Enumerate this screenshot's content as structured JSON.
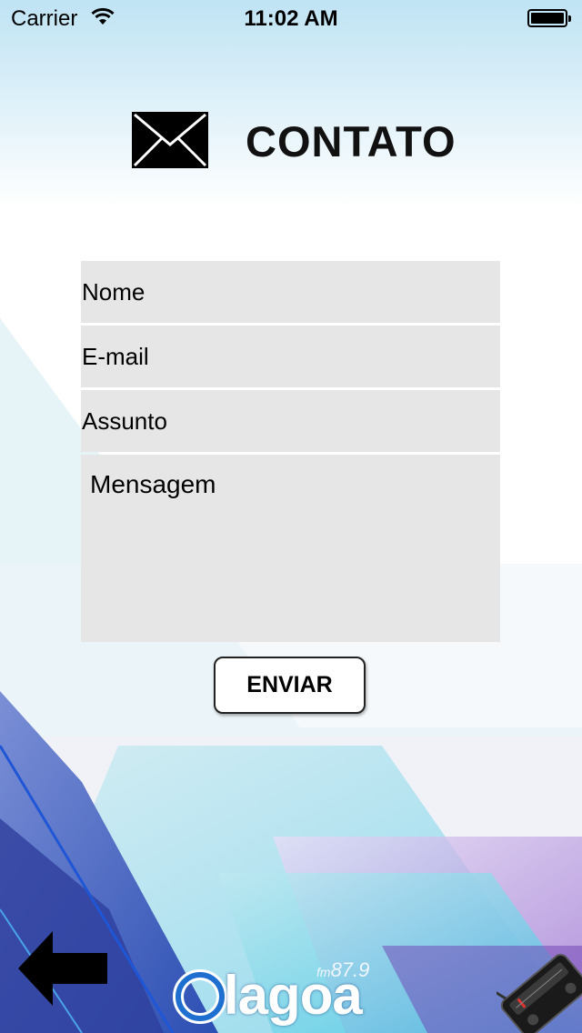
{
  "status_bar": {
    "carrier": "Carrier",
    "time": "11:02 AM"
  },
  "header": {
    "title": "CONTATO",
    "icon": "envelope-icon"
  },
  "form": {
    "name_placeholder": "Nome",
    "email_placeholder": "E-mail",
    "subject_placeholder": "Assunto",
    "message_placeholder": "Mensagem",
    "name_value": "",
    "email_value": "",
    "subject_value": "",
    "message_value": ""
  },
  "actions": {
    "send_label": "ENVIAR",
    "back_icon": "back-arrow-icon"
  },
  "footer": {
    "logo_text": "lagoa",
    "logo_fm_prefix": "fm",
    "logo_frequency": "87.9",
    "radio_icon": "radio-icon"
  },
  "colors": {
    "top_gradient": "#bfe3f3",
    "field_background": "#e6e6e6",
    "accent_blue": "#2f5ec0",
    "accent_cyan": "#46c8e2",
    "accent_purple": "#8a5fc8"
  }
}
